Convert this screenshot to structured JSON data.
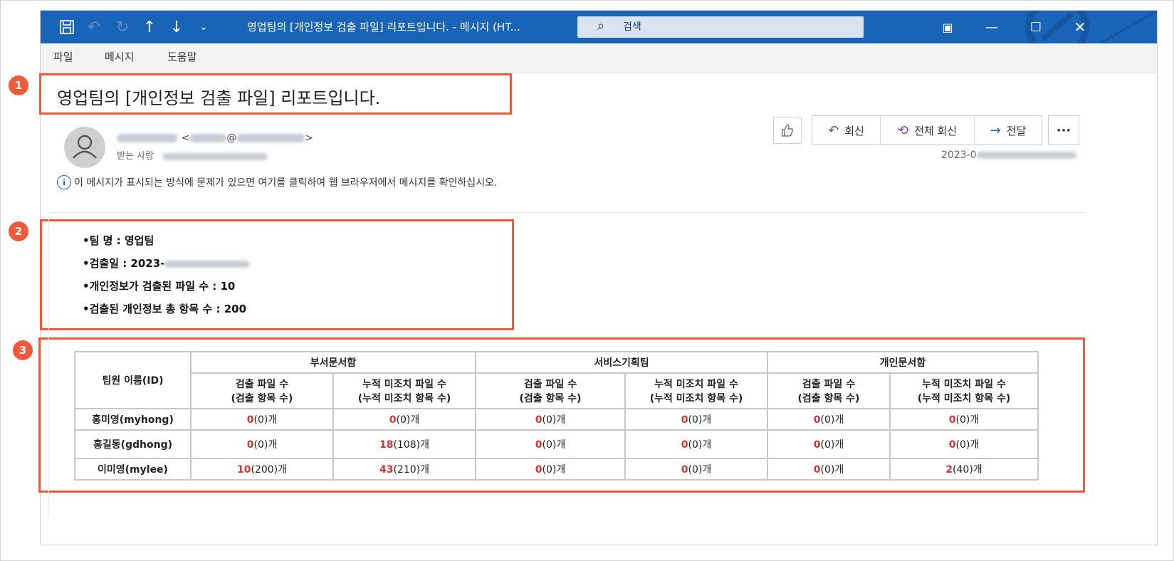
{
  "window": {
    "title": "영업팀의 [개인정보 검출 파일] 리포트입니다.  -  메시지 (HT...",
    "search_placeholder": "검색"
  },
  "menu": [
    "파일",
    "메시지",
    "도움말"
  ],
  "badges": [
    "1",
    "2",
    "3"
  ],
  "message": {
    "subject": "영업팀의 [개인정보 검출 파일] 리포트입니다.",
    "sender_open": "<",
    "sender_at": "@",
    "sender_close": ">",
    "to_label": "받는 사람",
    "info_text": "이 메시지가 표시되는 방식에 문제가 있으면 여기를 클릭하여 웹 브라우저에서 메시지를 확인하십시오.",
    "date_prefix": "2023-0"
  },
  "actions": {
    "reply": "회신",
    "reply_all": "전체 회신",
    "forward": "전달",
    "more": "···"
  },
  "summary": {
    "team": "•팀 명 : 영업팀",
    "date": "•검출일 : 2023-",
    "files": "•개인정보가 검출된 파일 수 : 10",
    "items": "•검출된 개인정보 총 항목 수 : 200"
  },
  "table": {
    "member_header": "팀원 이름(ID)",
    "groups": [
      "부서문서함",
      "서비스기획팀",
      "개인문서함"
    ],
    "sub1_a": "검출 파일 수",
    "sub1_b": "(검출 항목 수)",
    "sub2_a": "누적 미조치 파일 수",
    "sub2_b": "(누적 미조치 항목 수)",
    "unit": "개",
    "rows": [
      {
        "name": "홍미영(myhong)",
        "cells": [
          [
            "0",
            "(0)"
          ],
          [
            "0",
            "(0)"
          ],
          [
            "0",
            "(0)"
          ],
          [
            "0",
            "(0)"
          ],
          [
            "0",
            "(0)"
          ],
          [
            "0",
            "(0)"
          ]
        ]
      },
      {
        "name": "홍길동(gdhong)",
        "cells": [
          [
            "0",
            "(0)"
          ],
          [
            "18",
            "(108)"
          ],
          [
            "0",
            "(0)"
          ],
          [
            "0",
            "(0)"
          ],
          [
            "0",
            "(0)"
          ],
          [
            "0",
            "(0)"
          ]
        ]
      },
      {
        "name": "이미영(mylee)",
        "cells": [
          [
            "10",
            "(200)"
          ],
          [
            "43",
            "(210)"
          ],
          [
            "0",
            "(0)"
          ],
          [
            "0",
            "(0)"
          ],
          [
            "0",
            "(0)"
          ],
          [
            "2",
            "(40)"
          ]
        ]
      }
    ]
  },
  "colors": {
    "titlebar": "#1a64b8",
    "highlight": "#ef5a3c",
    "value_red": "#d8312f"
  },
  "icons": {
    "save": "save-icon",
    "undo": "undo-icon",
    "redo": "redo-icon",
    "up": "arrow-up-icon",
    "down": "arrow-down-icon",
    "customize": "customize-icon",
    "search": "search-icon",
    "like": "thumbs-up-icon",
    "info": "info-icon"
  }
}
